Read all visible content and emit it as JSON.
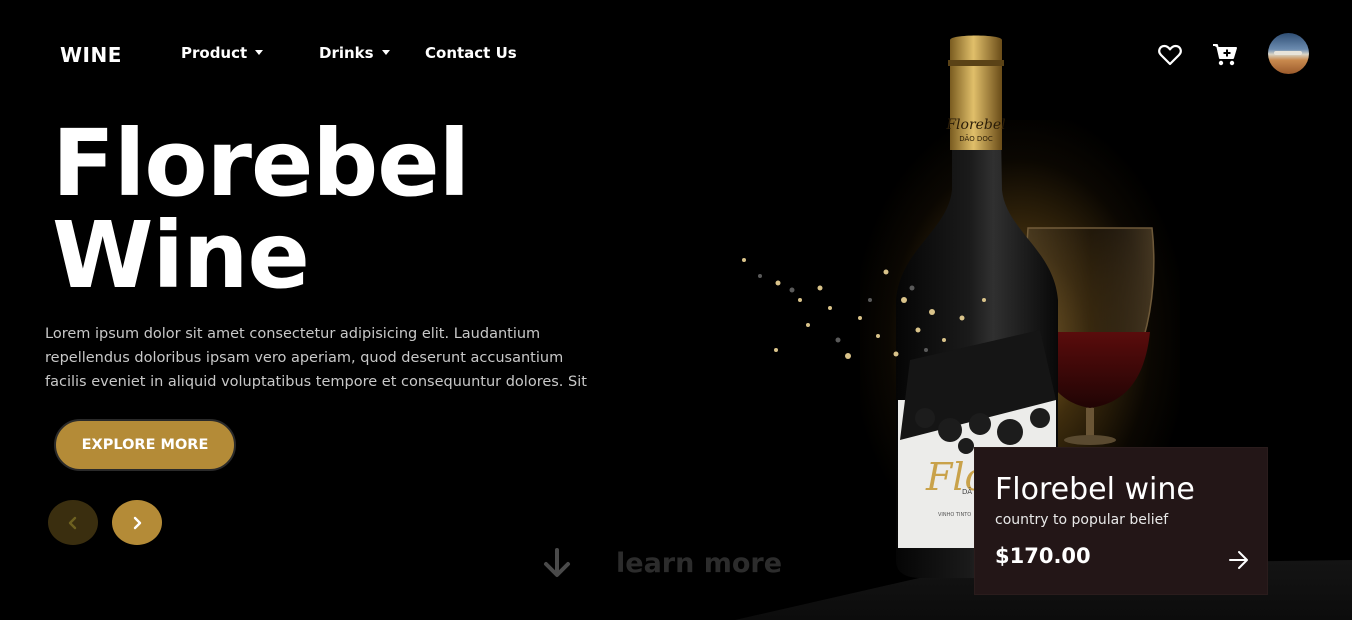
{
  "header": {
    "brand": "WINE",
    "nav": [
      {
        "label": "Product",
        "has_dropdown": true
      },
      {
        "label": "Drinks",
        "has_dropdown": true
      },
      {
        "label": "Contact Us",
        "has_dropdown": false
      }
    ],
    "icons": [
      "heart-icon",
      "cart-plus-icon"
    ]
  },
  "hero": {
    "title_line1": "Florebel",
    "title_line2": "Wine",
    "description": "Lorem ipsum dolor sit amet consectetur adipisicing elit. Laudantium repellendus doloribus ipsam vero aperiam, quod deserunt accusantium facilis eveniet in aliquid voluptatibus tempore et consequuntur dolores. Sit",
    "cta_label": "EXPLORE MORE",
    "learn_more": "learn more"
  },
  "product_card": {
    "name": "Florebel wine",
    "tagline": "country to popular belief",
    "price": "$170.00"
  },
  "bottle_label": {
    "script": "Florebel",
    "sub": "DÃO DOC",
    "front_script": "Flo",
    "front_sub": "DÃ",
    "front_small": "VINHO TINTO"
  },
  "colors": {
    "accent": "#b48b37",
    "accent_dark": "#3a2e0f",
    "card_bg": "#231617",
    "background": "#000000"
  }
}
